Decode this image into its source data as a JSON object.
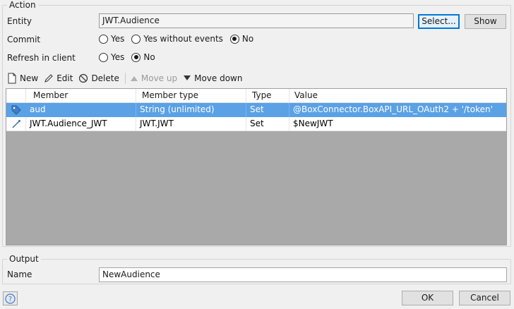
{
  "action_group": {
    "legend": "Action",
    "entity": {
      "label": "Entity",
      "value": "JWT.Audience",
      "select_label": "Select...",
      "show_label": "Show"
    },
    "commit": {
      "label": "Commit",
      "options": [
        "Yes",
        "Yes without events",
        "No"
      ],
      "selected": "No"
    },
    "refresh": {
      "label": "Refresh in client",
      "options": [
        "Yes",
        "No"
      ],
      "selected": "No"
    }
  },
  "toolbar": {
    "new_label": "New",
    "edit_label": "Edit",
    "delete_label": "Delete",
    "move_up_label": "Move up",
    "move_down_label": "Move down"
  },
  "grid": {
    "columns": [
      "Member",
      "Member type",
      "Type",
      "Value"
    ],
    "rows": [
      {
        "icon": "tag-icon",
        "member": "aud",
        "member_type": "String (unlimited)",
        "type": "Set",
        "value": "@BoxConnector.BoxAPI_URL_OAuth2 + '/token'",
        "selected": true
      },
      {
        "icon": "association-icon",
        "member": "JWT.Audience_JWT",
        "member_type": "JWT.JWT",
        "type": "Set",
        "value": "$NewJWT",
        "selected": false
      }
    ]
  },
  "output_group": {
    "legend": "Output",
    "name_label": "Name",
    "name_value": "NewAudience"
  },
  "footer": {
    "help_label": "?",
    "ok_label": "OK",
    "cancel_label": "Cancel"
  },
  "colors": {
    "selected_row": "#5aa1e6",
    "grid_background": "#a9a9a9",
    "focus_border": "#0078d7"
  }
}
